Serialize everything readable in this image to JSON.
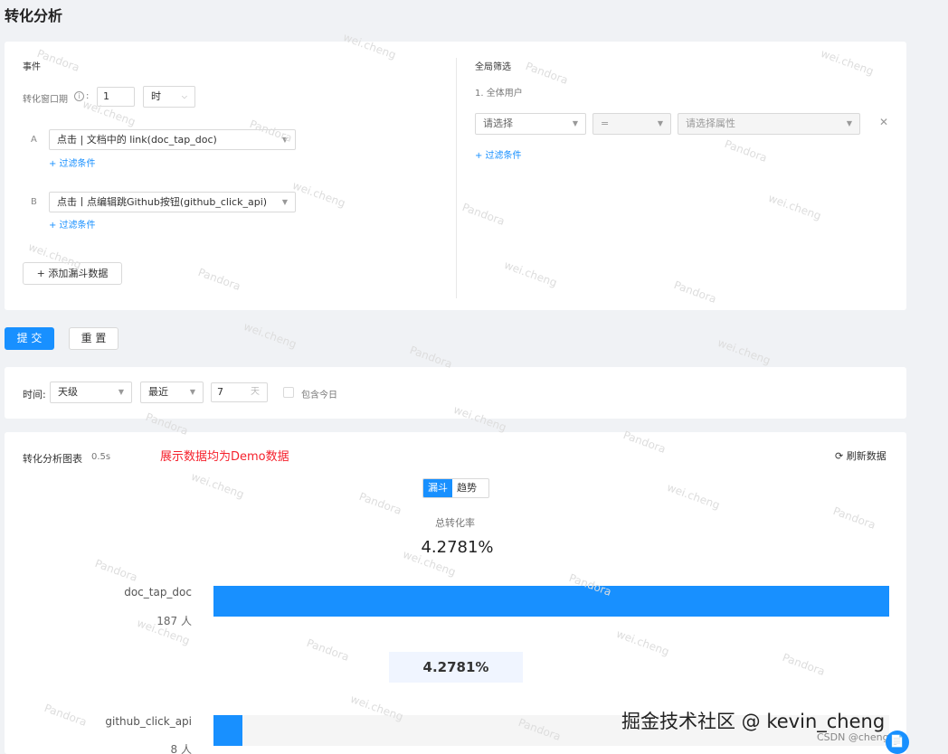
{
  "page": {
    "title": "转化分析"
  },
  "events": {
    "section_title": "事件",
    "window_label": "转化窗口期",
    "help_icon": "info-circle-icon",
    "window_value": "1",
    "window_unit": "时",
    "steps": [
      {
        "letter": "A",
        "event": "点击 | 文档中的 link(doc_tap_doc)",
        "filter_link": "+ 过滤条件"
      },
      {
        "letter": "B",
        "event": "点击丨点编辑跳Github按钮(github_click_api)",
        "filter_link": "+ 过滤条件"
      }
    ],
    "add_button": "+ 添加漏斗数据"
  },
  "global_filter": {
    "section_title": "全局筛选",
    "audience": "1. 全体用户",
    "field_placeholder": "请选择",
    "operator": "=",
    "value_placeholder": "请选择属性",
    "close_icon": "close-icon",
    "filter_link": "+ 过滤条件"
  },
  "actions": {
    "submit": "提 交",
    "reset": "重 置"
  },
  "time": {
    "label": "时间:",
    "granularity": "天级",
    "range_type": "最近",
    "range_value": "7",
    "range_unit": "天",
    "include_today": "包含今日"
  },
  "chart": {
    "title": "转化分析图表",
    "duration": "0.5s",
    "demo_note": "展示数据均为Demo数据",
    "refresh": "刷新数据",
    "refresh_icon": "refresh-icon",
    "toggle": [
      "漏斗",
      "趋势"
    ],
    "total_label": "总转化率",
    "total_rate": "4.2781%",
    "accent_color": "#1890ff",
    "demo_color": "#f5222d"
  },
  "chart_data": {
    "type": "bar",
    "orientation": "horizontal",
    "categories": [
      "doc_tap_doc",
      "github_click_api"
    ],
    "count_labels": [
      "187 人",
      "8 人"
    ],
    "values": [
      187,
      8
    ],
    "step_rates": [
      "4.2781%"
    ]
  },
  "watermarks": [
    "Pandora",
    "wei.cheng"
  ],
  "footer": {
    "watermark": "掘金技术社区 @ kevin_cheng",
    "csdn": "CSDN @cheng14",
    "float_icon": "document-icon"
  }
}
